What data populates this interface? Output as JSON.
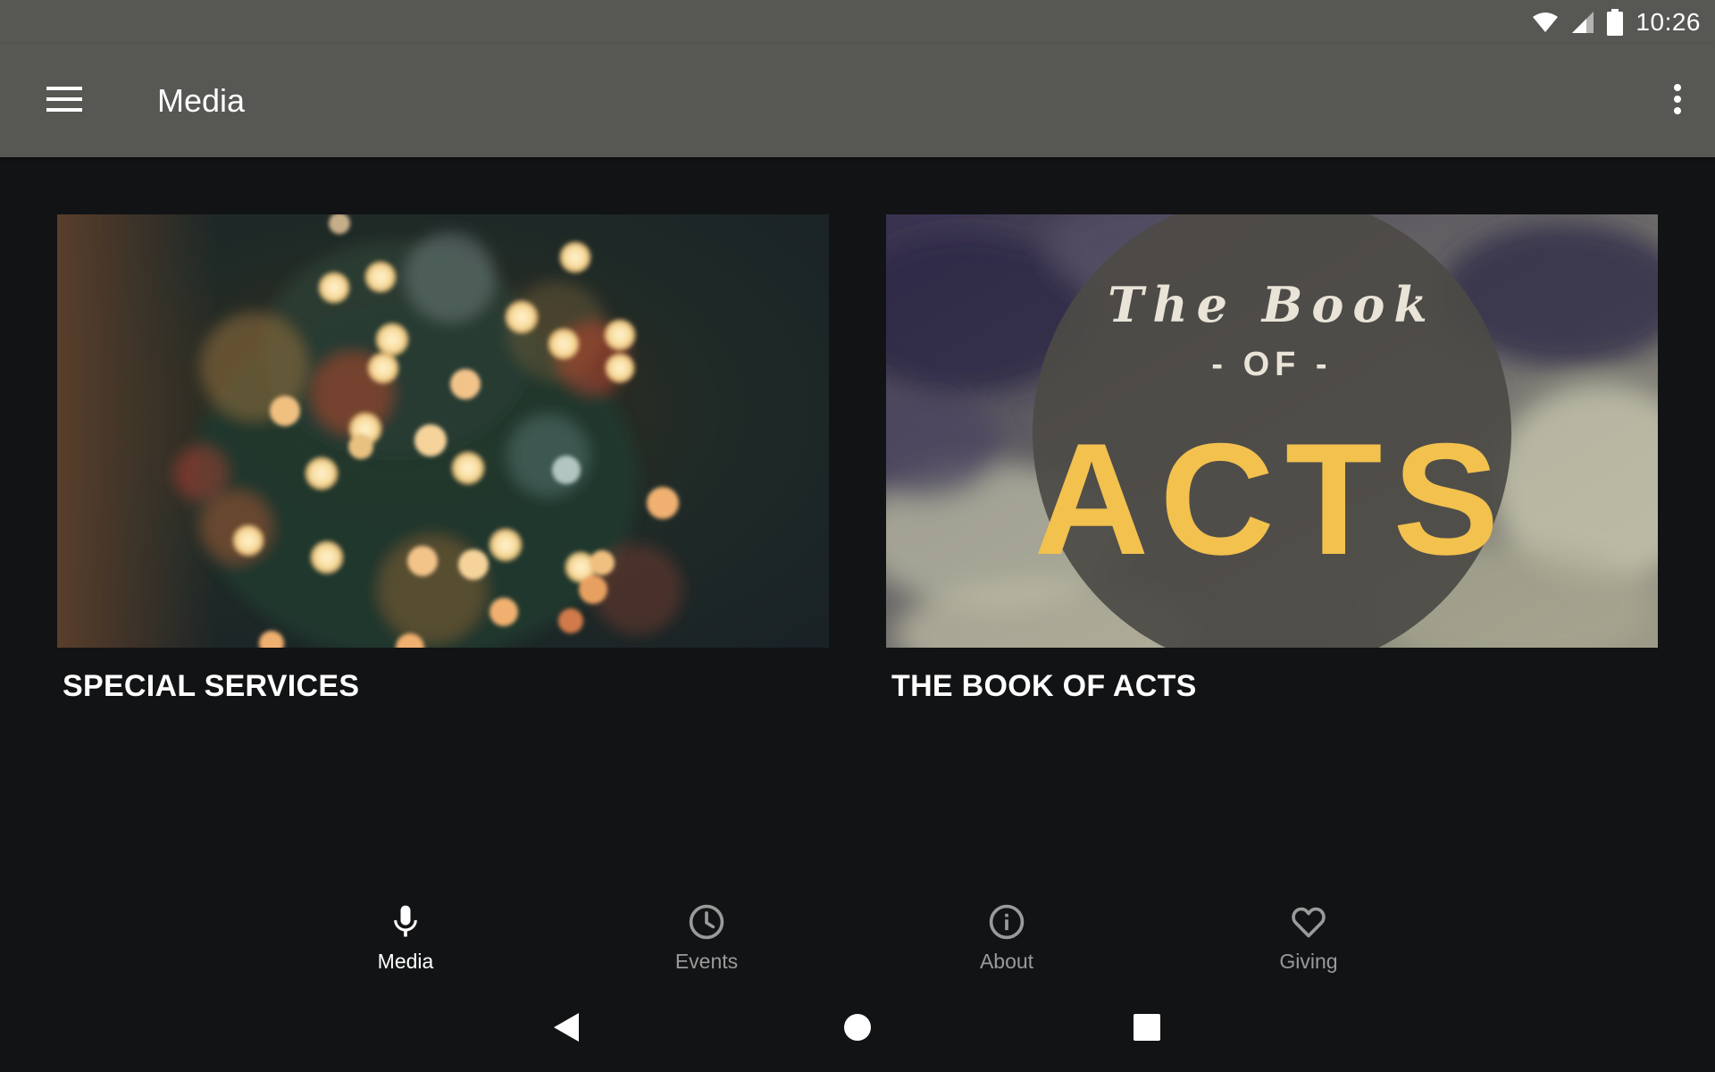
{
  "status_bar": {
    "time": "10:26",
    "icons": [
      "wifi-icon",
      "signal-icon",
      "battery-icon"
    ]
  },
  "app_bar": {
    "title": "Media",
    "menu_icon": "hamburger-menu-icon",
    "overflow_icon": "more-vert-icon"
  },
  "cards": [
    {
      "title": "SPECIAL SERVICES",
      "image": "christmas-tree-bokeh"
    },
    {
      "title": "THE BOOK OF ACTS",
      "image": "book-of-acts-artwork",
      "art_text": {
        "line1": "The Book",
        "line2": "- OF -",
        "line3": "ACTS"
      }
    }
  ],
  "bottom_nav": {
    "items": [
      {
        "label": "Media",
        "icon": "microphone-icon",
        "active": true
      },
      {
        "label": "Events",
        "icon": "clock-icon",
        "active": false
      },
      {
        "label": "About",
        "icon": "info-icon",
        "active": false
      },
      {
        "label": "Giving",
        "icon": "heart-icon",
        "active": false
      }
    ]
  },
  "system_nav": {
    "icons": [
      "back-icon",
      "home-icon",
      "recents-icon"
    ]
  },
  "colors": {
    "app_bar": "#575754",
    "background": "#121315",
    "active_label": "#ffffff",
    "inactive_label": "#9a9a9a",
    "acts_yellow": "#f2c14e"
  }
}
